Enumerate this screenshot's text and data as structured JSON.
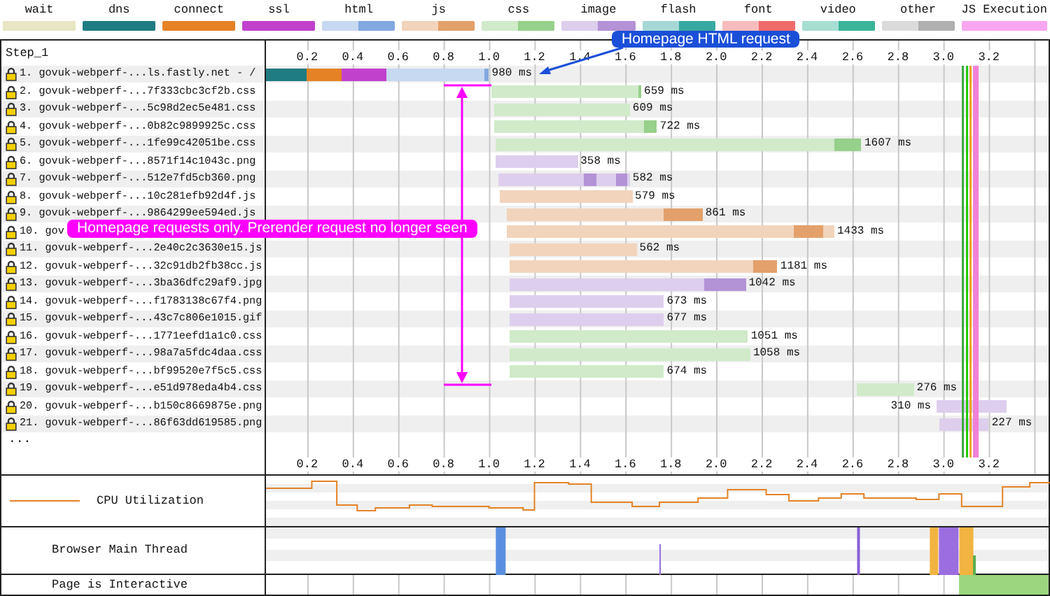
{
  "legend": [
    {
      "label": "wait",
      "kind": "single",
      "color": "#e8e6c4"
    },
    {
      "label": "dns",
      "kind": "single",
      "color": "#1f7c83"
    },
    {
      "label": "connect",
      "kind": "single",
      "color": "#e58226"
    },
    {
      "label": "ssl",
      "kind": "single",
      "color": "#c141cd"
    },
    {
      "label": "html",
      "kind": "split",
      "color": "#82a8e0"
    },
    {
      "label": "js",
      "kind": "split",
      "color": "#e3a06a"
    },
    {
      "label": "css",
      "kind": "split",
      "color": "#96d08a"
    },
    {
      "label": "image",
      "kind": "split",
      "color": "#b392d6"
    },
    {
      "label": "flash",
      "kind": "split",
      "color": "#38a8a2"
    },
    {
      "label": "font",
      "kind": "split",
      "color": "#f06a6a"
    },
    {
      "label": "video",
      "kind": "split",
      "color": "#3ab59a"
    },
    {
      "label": "other",
      "kind": "split",
      "color": "#b0b0b0"
    },
    {
      "label": "JS Execution",
      "kind": "single",
      "color": "#f9a6f0"
    }
  ],
  "annotations": [
    {
      "kind": "callout",
      "text": "Homepage HTML request",
      "color": "#1a4fd8"
    },
    {
      "kind": "bracket",
      "text": "Homepage requests only. Prerender request no longer seen",
      "color": "#ff00ff"
    }
  ],
  "waterfall": {
    "step": "Step_1",
    "ticks": [
      "0.2",
      "0.4",
      "0.6",
      "0.8",
      "1.0",
      "1.2",
      "1.4",
      "1.6",
      "1.8",
      "2.0",
      "2.2",
      "2.4",
      "2.6",
      "2.8",
      "3.0",
      "3.2"
    ],
    "bottom_ticks": [
      "0.2",
      "0.4",
      "0.6",
      "0.8",
      "1.0",
      "1.2",
      "1.4",
      "1.6",
      "1.8",
      "2.0",
      "2.2",
      "2.4",
      "2.6",
      "2.8",
      "3.0",
      "3.2"
    ],
    "requests": [
      {
        "number": "1.",
        "url": "govuk-webperf-...ls.fastly.net - /",
        "kind": "html",
        "secure": true,
        "duration": "980 ms"
      },
      {
        "number": "2.",
        "url": "govuk-webperf-...7f333cbc3cf2b.css",
        "kind": "css",
        "secure": true,
        "duration": "659 ms"
      },
      {
        "number": "3.",
        "url": "govuk-webperf-...5c98d2ec5e481.css",
        "kind": "css",
        "secure": true,
        "duration": "609 ms"
      },
      {
        "number": "4.",
        "url": "govuk-webperf-...0b82c9899925c.css",
        "kind": "css",
        "secure": true,
        "duration": "722 ms"
      },
      {
        "number": "5.",
        "url": "govuk-webperf-...1fe99c42051be.css",
        "kind": "css",
        "secure": true,
        "duration": "1607 ms"
      },
      {
        "number": "6.",
        "url": "govuk-webperf-...8571f14c1043c.png",
        "kind": "image",
        "secure": true,
        "duration": "358 ms"
      },
      {
        "number": "7.",
        "url": "govuk-webperf-...512e7fd5cb360.png",
        "kind": "image",
        "secure": true,
        "duration": "582 ms"
      },
      {
        "number": "8.",
        "url": "govuk-webperf-...10c281efb92d4f.js",
        "kind": "js",
        "secure": true,
        "duration": "579 ms"
      },
      {
        "number": "9.",
        "url": "govuk-webperf-...9864299ee594ed.js",
        "kind": "js",
        "secure": true,
        "duration": "861 ms"
      },
      {
        "number": "10.",
        "url": "gov",
        "kind": "js",
        "secure": true,
        "duration": "1433 ms"
      },
      {
        "number": "11.",
        "url": "govuk-webperf-...2e40c2c3630e15.js",
        "kind": "js",
        "secure": true,
        "duration": "562 ms"
      },
      {
        "number": "12.",
        "url": "govuk-webperf-...32c91db2fb38cc.js",
        "kind": "js",
        "secure": true,
        "duration": "1181 ms"
      },
      {
        "number": "13.",
        "url": "govuk-webperf-...3ba36dfc29af9.jpg",
        "kind": "image",
        "secure": true,
        "duration": "1042 ms"
      },
      {
        "number": "14.",
        "url": "govuk-webperf-...f1783138c67f4.png",
        "kind": "image",
        "secure": true,
        "duration": "673 ms"
      },
      {
        "number": "15.",
        "url": "govuk-webperf-...43c7c806e1015.gif",
        "kind": "image",
        "secure": true,
        "duration": "677 ms"
      },
      {
        "number": "16.",
        "url": "govuk-webperf-...1771eefd1a1c0.css",
        "kind": "css",
        "secure": true,
        "duration": "1051 ms"
      },
      {
        "number": "17.",
        "url": "govuk-webperf-...98a7a5fdc4daa.css",
        "kind": "css",
        "secure": true,
        "duration": "1058 ms"
      },
      {
        "number": "18.",
        "url": "govuk-webperf-...bf99520e7f5c5.css",
        "kind": "css",
        "secure": true,
        "duration": "674 ms"
      },
      {
        "number": "19.",
        "url": "govuk-webperf-...e51d978eda4b4.css",
        "kind": "css",
        "secure": true,
        "duration": "276 ms"
      },
      {
        "number": "20.",
        "url": "govuk-webperf-...b150c8669875e.png",
        "kind": "image",
        "secure": true,
        "duration": "310 ms"
      },
      {
        "number": "21.",
        "url": "govuk-webperf-...86f63dd619585.png",
        "kind": "image",
        "secure": true,
        "duration": "227 ms"
      }
    ],
    "more": "..."
  },
  "metrics": [
    {
      "kind": "cpu",
      "label": "CPU Utilization"
    },
    {
      "kind": "thread",
      "label": "Browser Main Thread"
    },
    {
      "kind": "interactive",
      "label": "Page is Interactive"
    }
  ]
}
